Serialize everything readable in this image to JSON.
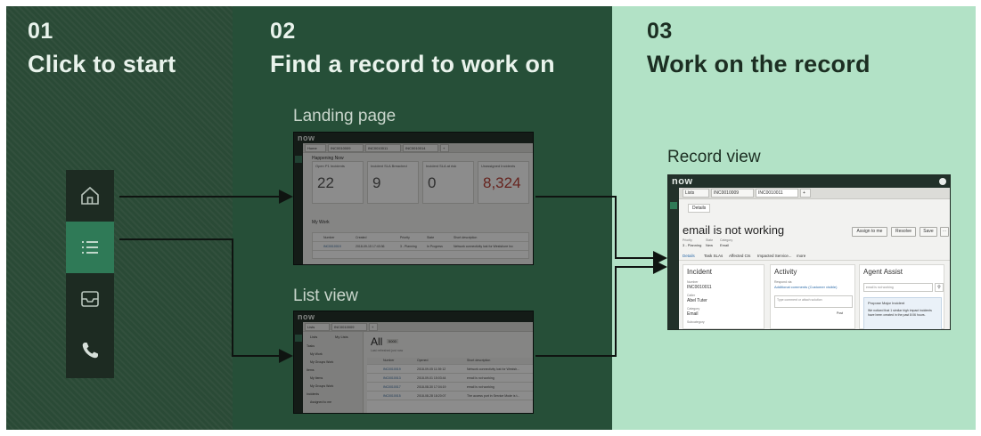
{
  "steps": [
    {
      "number": "01",
      "title": "Click to start"
    },
    {
      "number": "02",
      "title": "Find a record to work on"
    },
    {
      "number": "03",
      "title": "Work on the record"
    }
  ],
  "labels": {
    "landing": "Landing page",
    "list": "List view",
    "record": "Record view"
  },
  "colors": {
    "panel1": "#2a4a36",
    "panel2": "#264f38",
    "panel3": "#b2e2c6",
    "nav_bg": "#1d2b22",
    "nav_active": "#2f7a57",
    "arrow": "#111111"
  },
  "nav_icons": [
    "home-icon",
    "list-icon",
    "inbox-icon",
    "phone-icon"
  ],
  "landing": {
    "logo": "now",
    "tabs": [
      "Home",
      "INC0010009",
      "INC0010011",
      "INC0010014",
      "+"
    ],
    "section": "Happening Now",
    "tiles": [
      {
        "title": "Open P1 Incidents",
        "value": "22"
      },
      {
        "title": "Incident SLA Breached",
        "value": "9"
      },
      {
        "title": "Incident SLA at risk",
        "value": "0"
      },
      {
        "title": "Unassigned Incidents",
        "value": "8,324"
      }
    ],
    "work_title": "My Work",
    "cols": [
      "Number",
      "Created",
      "Priority",
      "State",
      "Short description"
    ],
    "row": [
      "INC0010019",
      "2018-09-15 17:43:36",
      "3 - Planning",
      "In Progress",
      "Network connectivity lost for Westshore Inc"
    ]
  },
  "list": {
    "logo": "now",
    "tabs": [
      "Lists",
      "INC0010009",
      "+"
    ],
    "filter_tabs": [
      "Lists",
      "My Lists"
    ],
    "sidebar": [
      "Tasks",
      "My Work",
      "My Groups Work",
      "Items",
      "My Items",
      "My Groups Work",
      "Incidents",
      "Assigned to me"
    ],
    "title": "All",
    "badge": "5000",
    "subtitle": "Last refreshed just now",
    "cols": [
      "Number",
      "Opened",
      "Short description"
    ],
    "rows": [
      [
        "INC0010019",
        "2018-09-05 11:39:12",
        "Network connectivity lost for Westsh..."
      ],
      [
        "INC0010013",
        "2018-09-01 15:03:44",
        "email is not working"
      ],
      [
        "INC0010017",
        "2018-08-30 17:04:19",
        "email is not working"
      ],
      [
        "INC0010015",
        "2018-08-28 18:20:07",
        "The access port in Service Mode is t..."
      ]
    ]
  },
  "record": {
    "logo": "now",
    "tabs": [
      "Lists",
      "INC0010009",
      "INC0010011",
      "+"
    ],
    "details_tab": "Details",
    "title": "email is not working",
    "meta": [
      {
        "label": "Priority",
        "value": "3 - Planning"
      },
      {
        "label": "State",
        "value": "New"
      },
      {
        "label": "Category",
        "value": "Email"
      }
    ],
    "buttons": [
      "Assign to me",
      "Resolve",
      "Save"
    ],
    "subtabs": [
      "Details",
      "Task SLAs",
      "Affected CIs",
      "Impacted Service...",
      "more"
    ],
    "incident": {
      "title": "Incident",
      "number_label": "Number",
      "number": "INC0010011",
      "caller_label": "Caller",
      "caller": "Abel Tuter",
      "category_label": "Category",
      "category": "Email",
      "subcategory_label": "Subcategory"
    },
    "activity": {
      "title": "Activity",
      "respond_label": "Respond via",
      "respond": "Additional comments (Customer visible)",
      "placeholder": "Type comment or attach solution",
      "post": "Post"
    },
    "agent": {
      "title": "Agent Assist",
      "search": "email is not working",
      "card_title": "Propose Major Incident",
      "card_text": "We noticed that 1 similar high impact incidents have been created in the past 8:06 hours."
    }
  }
}
